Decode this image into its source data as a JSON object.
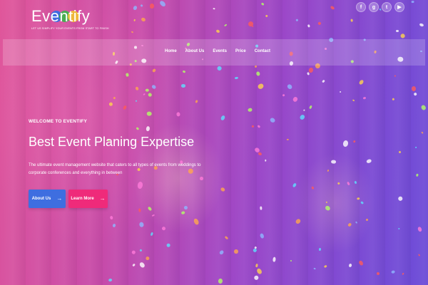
{
  "logo": {
    "name": "Eventify",
    "tagline": "LET US SIMPLIFY YOUR EVENTS FROM START TO FINISH",
    "circle_colors": [
      "#2f6ee8",
      "#3ab54a",
      "#f2c230"
    ]
  },
  "social": [
    {
      "icon": "facebook-icon",
      "glyph": "f"
    },
    {
      "icon": "google-plus-icon",
      "glyph": "g"
    },
    {
      "icon": "twitter-icon",
      "glyph": "t"
    },
    {
      "icon": "youtube-icon",
      "glyph": "▶"
    }
  ],
  "nav": {
    "items": [
      "Home",
      "About Us",
      "Events",
      "Price",
      "Contact"
    ]
  },
  "hero": {
    "welcome": "WELCOME TO EVENTIFY",
    "headline": "Best Event Planing Expertise",
    "description": "The ultimate event management website that caters to all types of events from weddings to corporate conferences and everything in between",
    "buttons": {
      "about_label": "About Us",
      "learn_label": "Learn More",
      "arrow": "→"
    }
  },
  "colors": {
    "about_button": "#3e6ee0",
    "learn_button": "#ef2a7a",
    "overlay_start": "#e0569a",
    "overlay_end": "#6b4cd8"
  }
}
